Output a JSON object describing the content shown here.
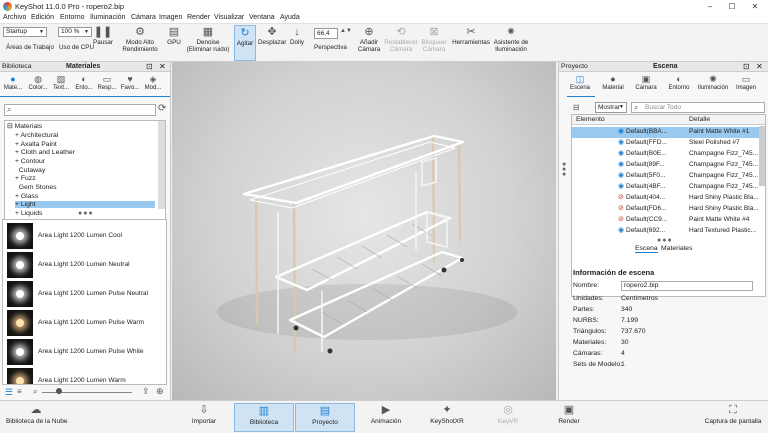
{
  "window": {
    "title": "KeyShot 11.0.0 Pro  - ropero2.bip",
    "minimize": "–",
    "maximize": "☐",
    "close": "✕"
  },
  "menu": [
    "Archivo",
    "Edición",
    "Entorno",
    "Iluminación",
    "Cámara",
    "Imagen",
    "Render",
    "Visualizar",
    "Ventana",
    "Ayuda"
  ],
  "toolbar": {
    "workspace": "Startup",
    "workspace_label": "Áreas de Trabajo",
    "cpu_value": "100 %",
    "cpu_label": "Uso de CPU",
    "pause": "Pausar",
    "model_label": "Modo Alto Rendimiento",
    "gpu": "GPU",
    "denoise": "Denoise (Eliminar ruido)",
    "tumble": "Agitar",
    "pan": "Desplazar",
    "dolly": "Dolly",
    "perspective_label": "Perspectiva",
    "perspective_value": "66,4",
    "add_camera": "Añadir Cámara",
    "reset_camera": "Restablecer Cámara",
    "lock_camera": "Bloquear Cámara",
    "tools": "Herramientas",
    "lighting_wizard": "Asistente de Iluminación"
  },
  "left_panel": {
    "header_left": "Biblioteca",
    "header_center": "Materiales",
    "tabs": [
      "Mate...",
      "Color...",
      "Text...",
      "Ento...",
      "Resp...",
      "Favo...",
      "Mod..."
    ],
    "tree_root": "Materials",
    "tree_items": [
      "Architectural",
      "Axalta Paint",
      "Cloth and Leather",
      "Contour",
      "Cutaway",
      "Fuzz",
      "Gem Stones",
      "Glass",
      "Light",
      "Liquids"
    ],
    "thumbnails": [
      "Area Light 1200 Lumen Cool",
      "Area Light 1200 Lumen Neutral",
      "Area Light 1200 Lumen Pulse Neutral",
      "Area Light 1200 Lumen Pulse Warm",
      "Area Light 1200 Lumen Pulse White",
      "Area Light 1200 Lumen Warm"
    ]
  },
  "right_panel": {
    "header_left": "Proyecto",
    "header_center": "Escena",
    "tabs": [
      "Escena",
      "Material",
      "Cámara",
      "Entorno",
      "Iluminación",
      "Imagen"
    ],
    "filter_button": "Mostrar",
    "search_placeholder": "Buscar Todo",
    "col_element": "Elemento",
    "col_detail": "Detalle",
    "rows": [
      {
        "name": "Default(BBA...",
        "mat": "Paint Matte White #1"
      },
      {
        "name": "Default(FFD...",
        "mat": "Steel Polished #7"
      },
      {
        "name": "Default(B0E...",
        "mat": "Champagne Fizz_745..."
      },
      {
        "name": "Default(89F...",
        "mat": "Champagne Fizz_745..."
      },
      {
        "name": "Default(5F0...",
        "mat": "Champagne Fizz_745..."
      },
      {
        "name": "Default(4BF...",
        "mat": "Champagne Fizz_745..."
      },
      {
        "name": "Default(404...",
        "mat": "Hard Shiny Plastic Bla..."
      },
      {
        "name": "Default(FD6...",
        "mat": "Hard Shiny Plastic Bla..."
      },
      {
        "name": "Default(CC9...",
        "mat": "Paint Matte White #4"
      },
      {
        "name": "Default(692...",
        "mat": "Hard Textured Plastic..."
      }
    ],
    "subtabs": [
      "Escena",
      "Materiales"
    ],
    "info_title": "Información de escena",
    "info": [
      {
        "k": "Nombre:",
        "v": "ropero2.bip"
      },
      {
        "k": "Unidades:",
        "v": "Centímetros"
      },
      {
        "k": "Partes:",
        "v": "340"
      },
      {
        "k": "NURBS:",
        "v": "7.199"
      },
      {
        "k": "Triángulos:",
        "v": "737.670"
      },
      {
        "k": "Materiales:",
        "v": "30"
      },
      {
        "k": "Cámaras:",
        "v": "4"
      },
      {
        "k": "Sets de Modelo:",
        "v": "1"
      }
    ]
  },
  "bottom": [
    "Biblioteca de la Nube",
    "Importar",
    "Biblioteca",
    "Proyecto",
    "Animación",
    "KeyShotXR",
    "KeyVR",
    "Render",
    "Captura de pantalla"
  ],
  "colors": {
    "accent": "#cfe3f5",
    "selection": "#99c9ef",
    "link": "#1a7fd1"
  }
}
